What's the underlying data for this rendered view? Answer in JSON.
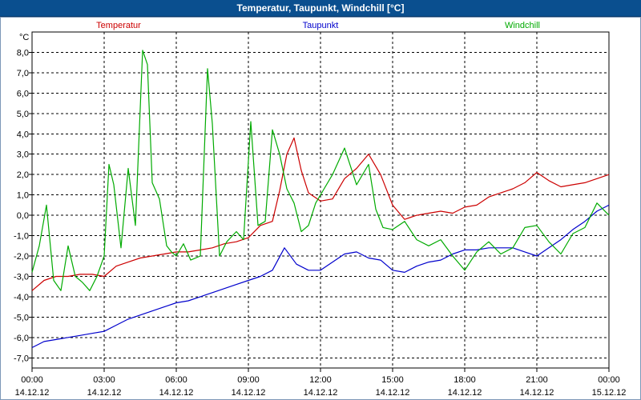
{
  "window": {
    "title": "Temperatur, Taupunkt, Windchill [°C]"
  },
  "chart_data": {
    "type": "line",
    "title": "Temperatur, Taupunkt, Windchill [°C]",
    "ylabel": "°C",
    "ylim": [
      -7.5,
      9.0
    ],
    "yticks": [
      -7.0,
      -6.0,
      -5.0,
      -4.0,
      -3.0,
      -2.0,
      -1.0,
      0.0,
      1.0,
      2.0,
      3.0,
      4.0,
      5.0,
      6.0,
      7.0,
      8.0
    ],
    "ytick_labels": [
      "-7,0",
      "-6,0",
      "-5,0",
      "-4,0",
      "-3,0",
      "-2,0",
      "-1,0",
      "0,0",
      "1,0",
      "2,0",
      "3,0",
      "4,0",
      "5,0",
      "6,0",
      "7,0",
      "8,0"
    ],
    "xlim": [
      0,
      24
    ],
    "xticks": [
      0,
      3,
      6,
      9,
      12,
      15,
      18,
      21,
      24
    ],
    "xtick_times": [
      "00:00",
      "03:00",
      "06:00",
      "09:00",
      "12:00",
      "15:00",
      "18:00",
      "21:00",
      "00:00"
    ],
    "xtick_dates": [
      "14.12.12",
      "14.12.12",
      "14.12.12",
      "14.12.12",
      "14.12.12",
      "14.12.12",
      "14.12.12",
      "14.12.12",
      "15.12.12"
    ],
    "grid": true,
    "legend_position": "top",
    "series": [
      {
        "name": "Temperatur",
        "color": "#cc0000",
        "x": [
          0,
          0.5,
          1,
          1.5,
          2,
          2.5,
          3,
          3.5,
          4,
          4.5,
          5,
          5.5,
          6,
          6.5,
          7,
          7.5,
          8,
          8.5,
          9,
          9.5,
          10,
          10.3,
          10.6,
          10.9,
          11.2,
          11.5,
          12,
          12.5,
          13,
          13.5,
          14,
          14.5,
          15,
          15.5,
          16,
          16.5,
          17,
          17.5,
          18,
          18.5,
          19,
          19.5,
          20,
          20.5,
          21,
          21.5,
          22,
          22.5,
          23,
          23.5,
          24
        ],
        "y": [
          -3.7,
          -3.2,
          -3.0,
          -3.0,
          -2.9,
          -2.9,
          -3.0,
          -2.5,
          -2.3,
          -2.1,
          -2.0,
          -1.9,
          -1.8,
          -1.8,
          -1.7,
          -1.6,
          -1.4,
          -1.3,
          -1.1,
          -0.5,
          -0.3,
          1.2,
          3.0,
          3.8,
          2.2,
          1.1,
          0.7,
          0.8,
          1.8,
          2.3,
          3.0,
          2.0,
          0.5,
          -0.2,
          0.0,
          0.1,
          0.2,
          0.1,
          0.4,
          0.5,
          0.9,
          1.1,
          1.3,
          1.6,
          2.1,
          1.7,
          1.4,
          1.5,
          1.6,
          1.8,
          2.0
        ]
      },
      {
        "name": "Taupunkt",
        "color": "#0000cc",
        "x": [
          0,
          0.5,
          1,
          1.5,
          2,
          2.5,
          3,
          3.5,
          4,
          4.5,
          5,
          5.5,
          6,
          6.5,
          7,
          7.5,
          8,
          8.5,
          9,
          9.5,
          10,
          10.5,
          11,
          11.5,
          12,
          12.5,
          13,
          13.5,
          14,
          14.5,
          15,
          15.5,
          16,
          16.5,
          17,
          17.5,
          18,
          18.5,
          19,
          19.5,
          20,
          20.5,
          21,
          21.5,
          22,
          22.5,
          23,
          23.5,
          24
        ],
        "y": [
          -6.5,
          -6.2,
          -6.1,
          -6.0,
          -5.9,
          -5.8,
          -5.7,
          -5.4,
          -5.1,
          -4.9,
          -4.7,
          -4.5,
          -4.3,
          -4.2,
          -4.0,
          -3.8,
          -3.6,
          -3.4,
          -3.2,
          -3.0,
          -2.7,
          -1.6,
          -2.4,
          -2.7,
          -2.7,
          -2.3,
          -1.9,
          -1.8,
          -2.1,
          -2.2,
          -2.7,
          -2.8,
          -2.5,
          -2.3,
          -2.2,
          -1.9,
          -1.7,
          -1.7,
          -1.6,
          -1.6,
          -1.6,
          -1.8,
          -2.0,
          -1.6,
          -1.2,
          -0.7,
          -0.3,
          0.2,
          0.5
        ]
      },
      {
        "name": "Windchill",
        "color": "#00aa00",
        "x": [
          0,
          0.3,
          0.6,
          0.9,
          1.2,
          1.5,
          1.8,
          2.1,
          2.4,
          2.7,
          3.0,
          3.2,
          3.4,
          3.7,
          4.0,
          4.3,
          4.6,
          4.8,
          5.0,
          5.3,
          5.6,
          5.8,
          6.0,
          6.3,
          6.6,
          7.0,
          7.3,
          7.5,
          7.8,
          8.1,
          8.5,
          8.8,
          9.1,
          9.4,
          9.7,
          10.0,
          10.3,
          10.6,
          10.9,
          11.2,
          11.5,
          11.8,
          12.1,
          12.5,
          13.0,
          13.5,
          14.0,
          14.3,
          14.6,
          15.0,
          15.5,
          16.0,
          16.5,
          17.0,
          17.5,
          18.0,
          18.5,
          19.0,
          19.5,
          20.0,
          20.5,
          21.0,
          21.5,
          22.0,
          22.5,
          23.0,
          23.5,
          24.0
        ],
        "y": [
          -2.8,
          -1.5,
          0.5,
          -3.2,
          -3.7,
          -1.5,
          -3.0,
          -3.3,
          -3.7,
          -3.0,
          -2.0,
          2.5,
          1.5,
          -1.6,
          2.3,
          -0.5,
          8.1,
          7.4,
          1.6,
          0.8,
          -1.5,
          -1.8,
          -2.0,
          -1.4,
          -2.2,
          -2.0,
          7.2,
          4.5,
          -2.0,
          -1.3,
          -0.8,
          -1.2,
          4.6,
          -0.5,
          -0.3,
          4.2,
          3.0,
          1.3,
          0.6,
          -0.8,
          -0.5,
          0.6,
          1.2,
          2.0,
          3.3,
          1.5,
          2.5,
          0.3,
          -0.6,
          -0.7,
          -0.3,
          -1.2,
          -1.5,
          -1.2,
          -2.0,
          -2.7,
          -1.8,
          -1.3,
          -1.9,
          -1.6,
          -0.6,
          -0.5,
          -1.3,
          -1.9,
          -0.9,
          -0.6,
          0.6,
          0.0
        ]
      }
    ]
  }
}
